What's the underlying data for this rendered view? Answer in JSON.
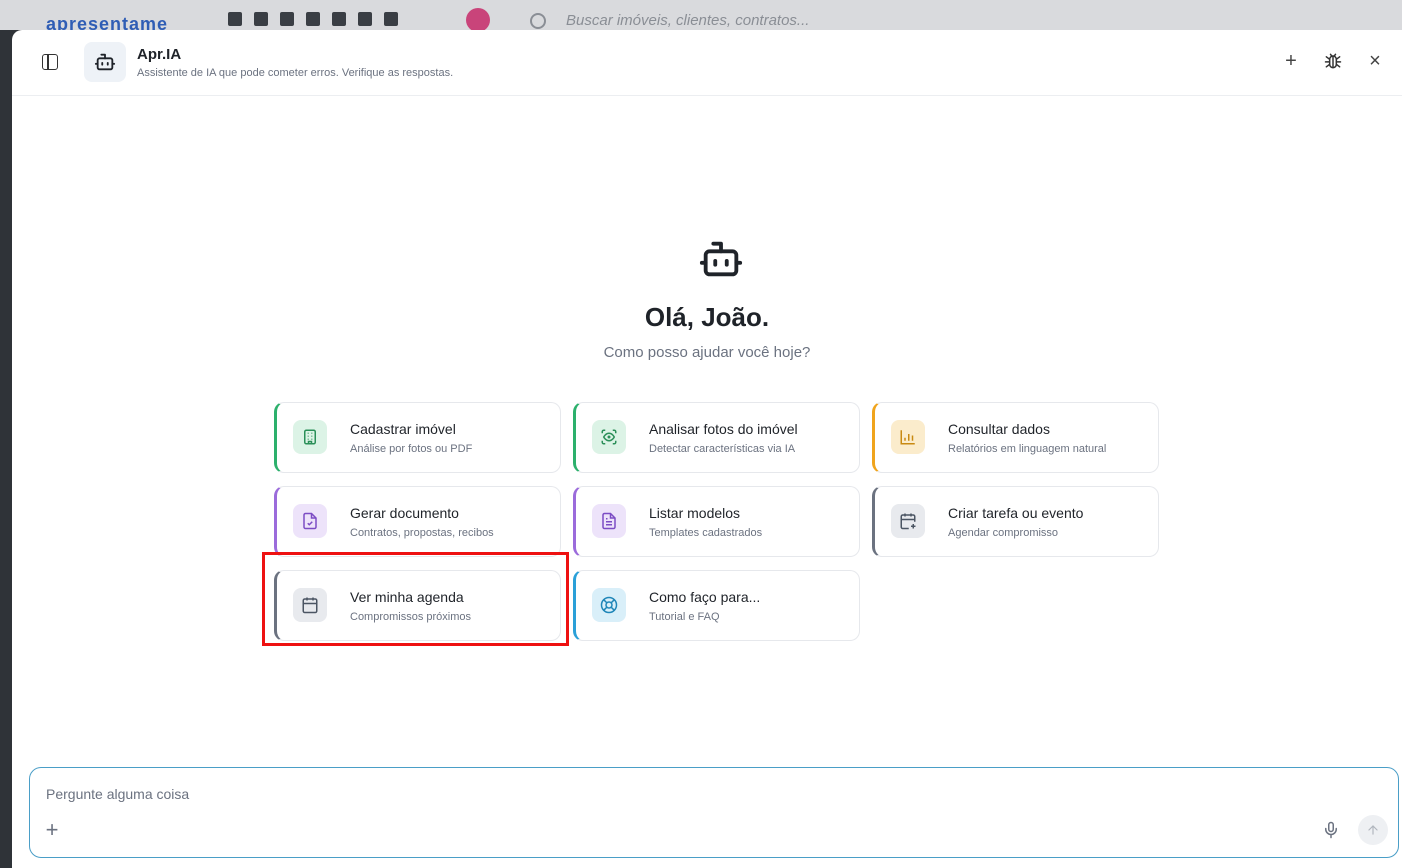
{
  "background": {
    "logo_text": "apresentame",
    "search_placeholder": "Buscar imóveis, clientes, contratos..."
  },
  "header": {
    "title": "Apr.IA",
    "subtitle": "Assistente de IA que pode cometer erros. Verifique as respostas.",
    "actions": {
      "new": "+",
      "debug": "bug-icon",
      "close": "×"
    }
  },
  "hero": {
    "greeting": "Olá, João.",
    "prompt": "Como posso ajudar você hoje?"
  },
  "cards": [
    {
      "title": "Cadastrar imóvel",
      "subtitle": "Análise por fotos ou PDF",
      "icon": "building-icon",
      "accent": "#2cb06c"
    },
    {
      "title": "Analisar fotos do imóvel",
      "subtitle": "Detectar características via IA",
      "icon": "scan-eye-icon",
      "accent": "#2cb06c"
    },
    {
      "title": "Consultar dados",
      "subtitle": "Relatórios em linguagem natural",
      "icon": "bar-chart-icon",
      "accent": "#f0a41c"
    },
    {
      "title": "Gerar documento",
      "subtitle": "Contratos, propostas, recibos",
      "icon": "file-check-icon",
      "accent": "#9b6bdb"
    },
    {
      "title": "Listar modelos",
      "subtitle": "Templates cadastrados",
      "icon": "file-text-icon",
      "accent": "#9b6bdb"
    },
    {
      "title": "Criar tarefa ou evento",
      "subtitle": "Agendar compromisso",
      "icon": "calendar-plus-icon",
      "accent": "#6b7280"
    },
    {
      "title": "Ver minha agenda",
      "subtitle": "Compromissos próximos",
      "icon": "calendar-icon",
      "accent": "#6b7280"
    },
    {
      "title": "Como faço para...",
      "subtitle": "Tutorial e FAQ",
      "icon": "lifebuoy-icon",
      "accent": "#2aa0d8"
    }
  ],
  "composer": {
    "placeholder": "Pergunte alguma coisa",
    "value": ""
  }
}
